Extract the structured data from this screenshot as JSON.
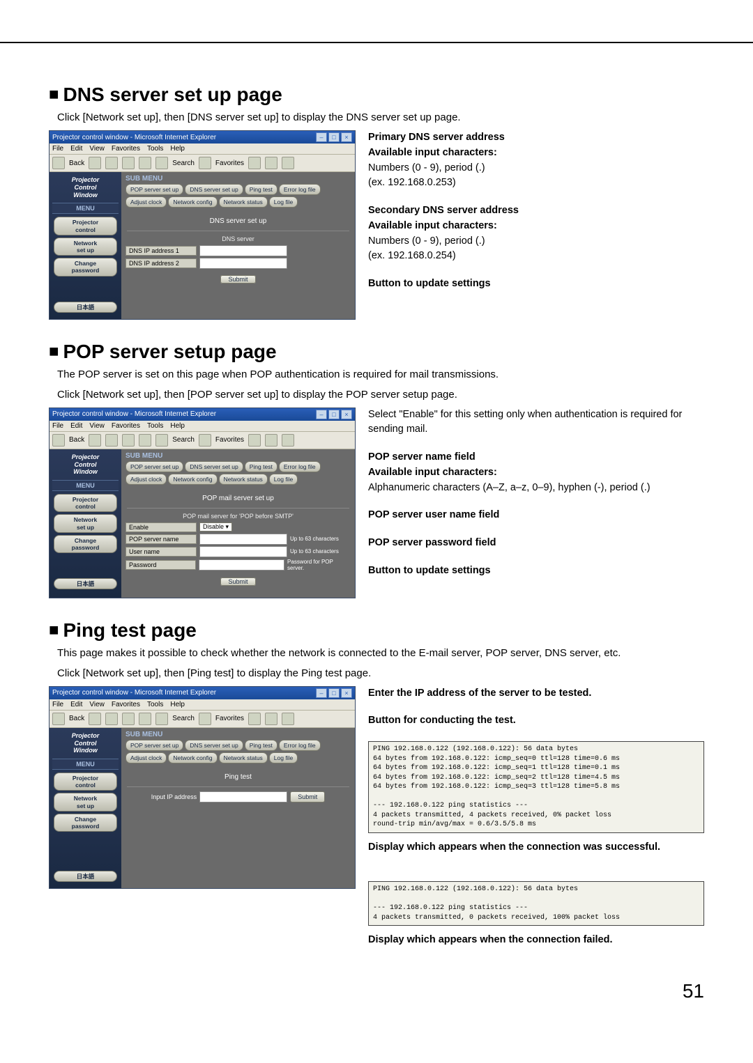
{
  "page_number": "51",
  "browser_title": "Projector control window - Microsoft Internet Explorer",
  "menu_items": [
    "File",
    "Edit",
    "View",
    "Favorites",
    "Tools",
    "Help"
  ],
  "toolbar": {
    "back": "Back",
    "search": "Search",
    "favorites": "Favorites"
  },
  "sidebar_logo": [
    "Projector",
    "Control",
    "Window"
  ],
  "sidebar_menu_label": "MENU",
  "sidebar_buttons": {
    "projector_control": "Projector\ncontrol",
    "network_setup": "Network\nset up",
    "change_password": "Change\npassword",
    "japanese": "日本語"
  },
  "submenu_label": "SUB MENU",
  "submenu_buttons": {
    "pop": "POP server set up",
    "dns": "DNS server set up",
    "ping": "Ping test",
    "errlog": "Error log file",
    "clock": "Adjust clock",
    "netcfg": "Network config",
    "netstat": "Network status",
    "logfile": "Log file"
  },
  "submit": "Submit",
  "dns": {
    "heading": "DNS server set up page",
    "body": "Click [Network set up], then [DNS server set up] to display the DNS server set up page.",
    "inner_title": "DNS server set up",
    "sub_title": "DNS server",
    "label1": "DNS IP address 1",
    "label2": "DNS IP address 2",
    "ann1_bold1": "Primary DNS server address",
    "ann1_bold2": "Available input characters:",
    "ann1_l1": "Numbers (0 - 9), period (.)",
    "ann1_l2": "(ex. 192.168.0.253)",
    "ann2_bold1": "Secondary DNS server address",
    "ann2_bold2": "Available input characters:",
    "ann2_l1": "Numbers (0 - 9), period (.)",
    "ann2_l2": "(ex. 192.168.0.254)",
    "ann3": "Button to update settings"
  },
  "pop": {
    "heading": "POP server setup page",
    "body1": "The POP server is set on this page when POP authentication is required for mail transmissions.",
    "body2": "Click [Network set up], then [POP server set up] to display the POP server setup page.",
    "inner_title": "POP mail server set up",
    "sub_title": "POP mail server for 'POP before SMTP'",
    "enable_label": "Enable",
    "enable_value": "Disable",
    "server_label": "POP server name",
    "user_label": "User name",
    "pass_label": "Password",
    "note_server": "Up to 63 characters",
    "note_user": "Up to 63 characters",
    "note_pass": "Password for POP server.",
    "ann0": "Select \"Enable\" for this setting only when authentication is required for sending mail.",
    "ann1_bold1": "POP server name field",
    "ann1_bold2": "Available input characters:",
    "ann1_l1": "Alphanumeric characters (A–Z, a–z, 0–9), hyphen (-), period (.)",
    "ann2": "POP server user name field",
    "ann3": "POP server password field",
    "ann4": "Button to update settings"
  },
  "ping": {
    "heading": "Ping test page",
    "body1": "This page makes it possible to check whether the network is connected to the E-mail server, POP server, DNS server, etc.",
    "body2": "Click [Network set up], then [Ping test] to display the Ping test page.",
    "inner_title": "Ping test",
    "input_label": "Input IP address",
    "ann1": "Enter the IP address of the server to be tested.",
    "ann2": "Button for conducting the test.",
    "ok_box": "PING 192.168.0.122 (192.168.0.122): 56 data bytes\n64 bytes from 192.168.0.122: icmp_seq=0 ttl=128 time=0.6 ms\n64 bytes from 192.168.0.122: icmp_seq=1 ttl=128 time=0.1 ms\n64 bytes from 192.168.0.122: icmp_seq=2 ttl=128 time=4.5 ms\n64 bytes from 192.168.0.122: icmp_seq=3 ttl=128 time=5.8 ms\n\n--- 192.168.0.122 ping statistics ---\n4 packets transmitted, 4 packets received, 0% packet loss\nround-trip min/avg/max = 0.6/3.5/5.8 ms",
    "ok_caption": "Display which appears when the connection was successful.",
    "fail_box": "PING 192.168.0.122 (192.168.0.122): 56 data bytes\n\n--- 192.168.0.122 ping statistics ---\n4 packets transmitted, 0 packets received, 100% packet loss",
    "fail_caption": "Display which appears when the connection failed."
  }
}
